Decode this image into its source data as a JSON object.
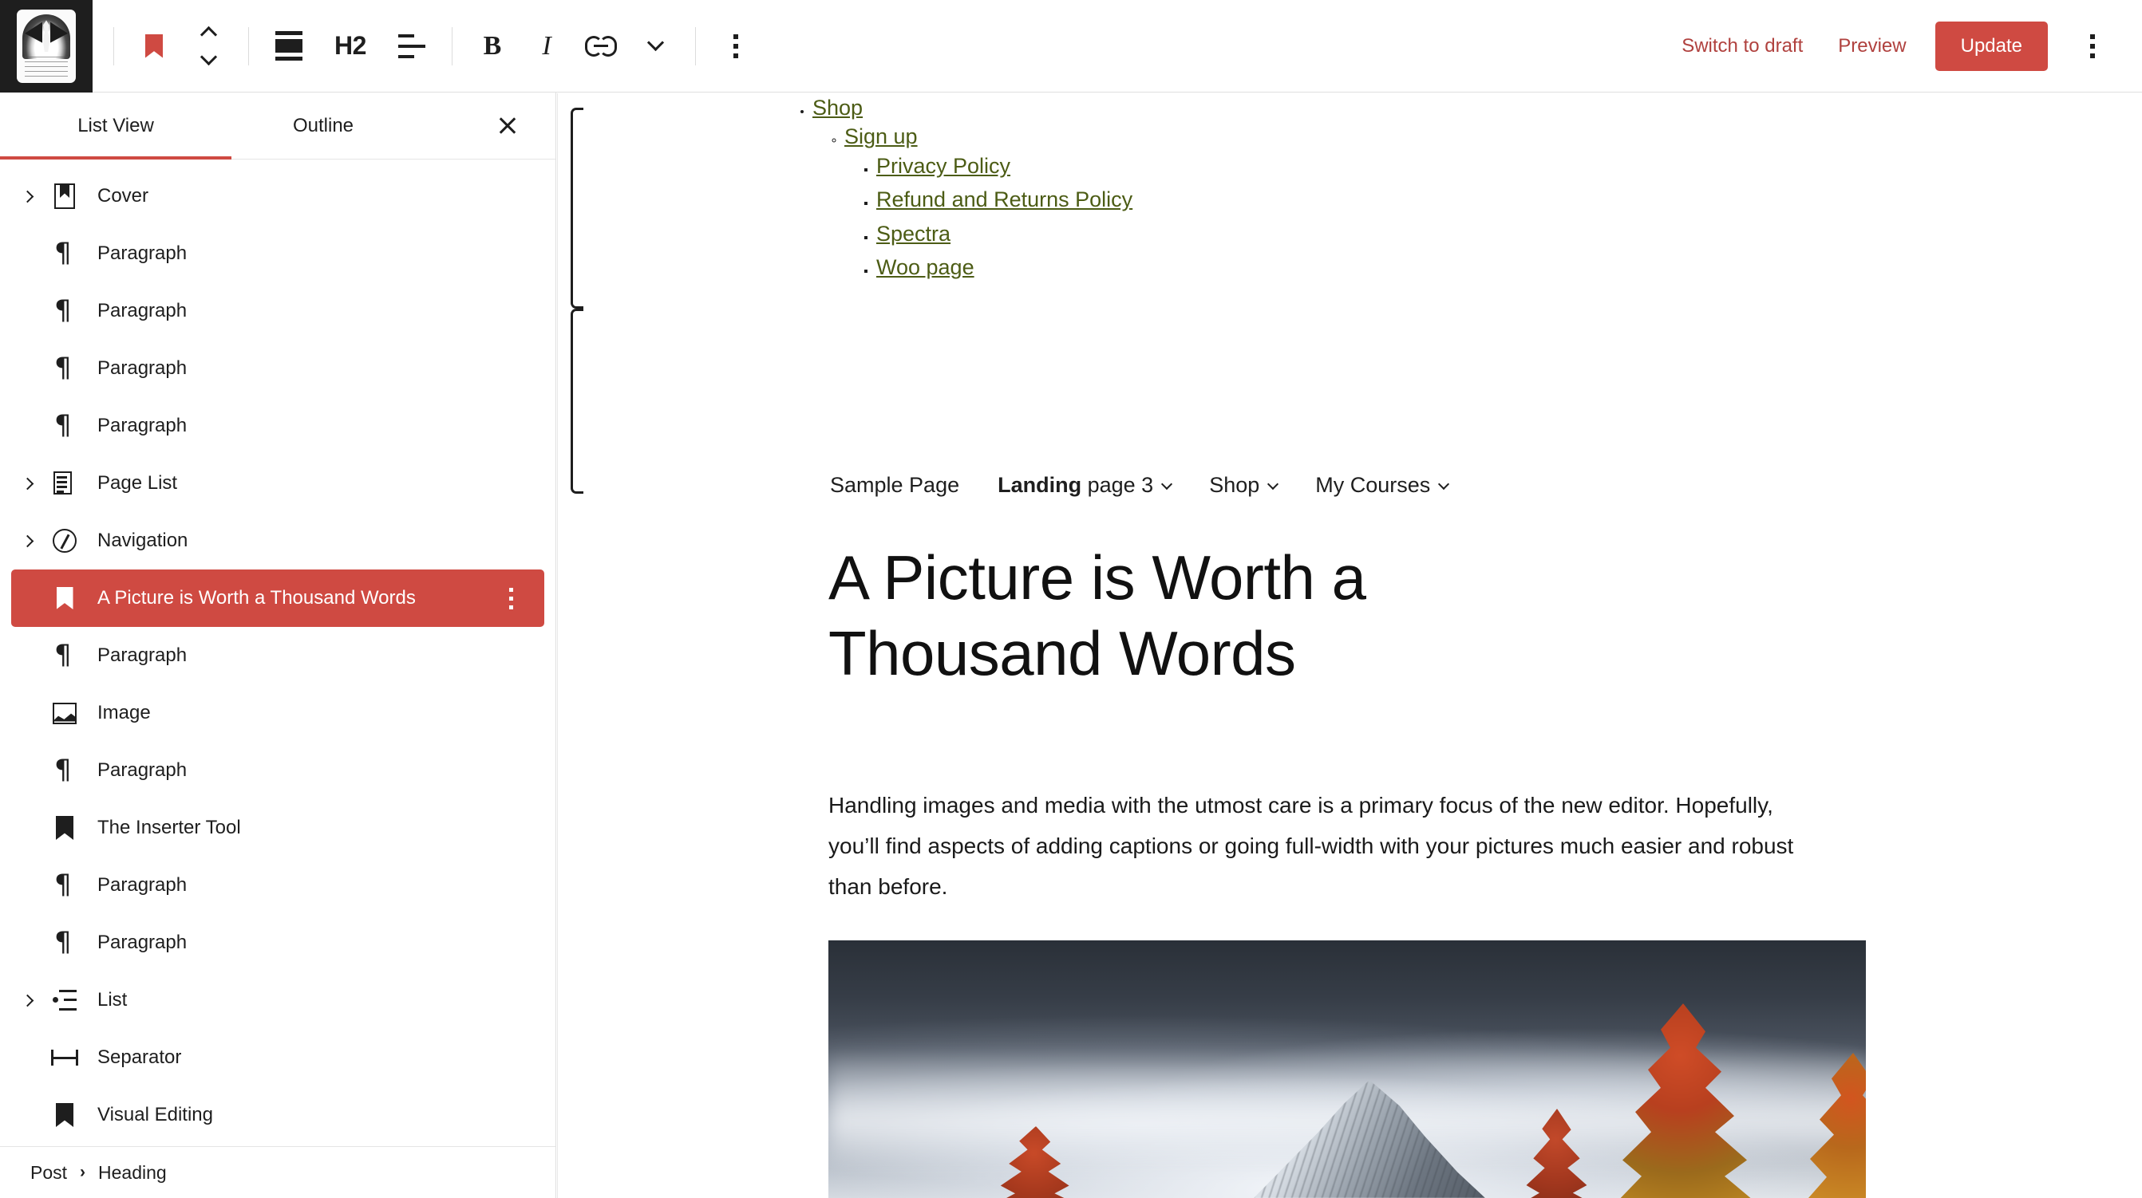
{
  "topbar": {
    "site_logo_alt": "site-icon",
    "tools": [
      {
        "name": "block-type-bookmark",
        "icon": "bookmark-icon",
        "label": ""
      },
      {
        "name": "move-up-down",
        "icon": "chevron-up-down-icon",
        "label": ""
      },
      {
        "name": "block-align",
        "icon": "align-block-icon",
        "label": ""
      },
      {
        "name": "heading-level",
        "icon": "heading-level-icon",
        "label": "H2"
      },
      {
        "name": "text-align",
        "icon": "align-text-icon",
        "label": ""
      },
      {
        "name": "bold",
        "icon": "bold-icon",
        "label": "B"
      },
      {
        "name": "italic",
        "icon": "italic-icon",
        "label": "I"
      },
      {
        "name": "link",
        "icon": "link-icon",
        "label": ""
      },
      {
        "name": "more-rich-text",
        "icon": "chevron-down-icon",
        "label": ""
      },
      {
        "name": "block-options",
        "icon": "kebab-menu-icon",
        "label": ""
      }
    ],
    "heading_level_label": "H2",
    "bold_label": "B",
    "italic_label": "I",
    "switch_to_draft_label": "Switch to draft",
    "preview_label": "Preview",
    "update_label": "Update",
    "more_options_label": "Options"
  },
  "listview": {
    "tabs": [
      {
        "label": "List View",
        "active": true
      },
      {
        "label": "Outline",
        "active": false
      }
    ],
    "close_label": "Close",
    "items": [
      {
        "label": "Cover",
        "icon": "cover-icon",
        "expandable": true,
        "selected": false,
        "indent": 0
      },
      {
        "label": "Paragraph",
        "icon": "paragraph-icon",
        "expandable": false,
        "selected": false,
        "indent": 0
      },
      {
        "label": "Paragraph",
        "icon": "paragraph-icon",
        "expandable": false,
        "selected": false,
        "indent": 0
      },
      {
        "label": "Paragraph",
        "icon": "paragraph-icon",
        "expandable": false,
        "selected": false,
        "indent": 0
      },
      {
        "label": "Paragraph",
        "icon": "paragraph-icon",
        "expandable": false,
        "selected": false,
        "indent": 0
      },
      {
        "label": "Page List",
        "icon": "page-list-icon",
        "expandable": true,
        "selected": false,
        "indent": 0
      },
      {
        "label": "Navigation",
        "icon": "navigation-icon",
        "expandable": true,
        "selected": false,
        "indent": 0
      },
      {
        "label": "A Picture is Worth a Thousand Words",
        "icon": "heading-icon",
        "expandable": false,
        "selected": true,
        "indent": 0
      },
      {
        "label": "Paragraph",
        "icon": "paragraph-icon",
        "expandable": false,
        "selected": false,
        "indent": 0
      },
      {
        "label": "Image",
        "icon": "image-icon",
        "expandable": false,
        "selected": false,
        "indent": 0
      },
      {
        "label": "Paragraph",
        "icon": "paragraph-icon",
        "expandable": false,
        "selected": false,
        "indent": 0
      },
      {
        "label": "The Inserter Tool",
        "icon": "heading-icon",
        "expandable": false,
        "selected": false,
        "indent": 0
      },
      {
        "label": "Paragraph",
        "icon": "paragraph-icon",
        "expandable": false,
        "selected": false,
        "indent": 0
      },
      {
        "label": "Paragraph",
        "icon": "paragraph-icon",
        "expandable": false,
        "selected": false,
        "indent": 0
      },
      {
        "label": "List",
        "icon": "list-icon",
        "expandable": true,
        "selected": false,
        "indent": 0
      },
      {
        "label": "Separator",
        "icon": "separator-icon",
        "expandable": false,
        "selected": false,
        "indent": 0
      },
      {
        "label": "Visual Editing",
        "icon": "heading-icon",
        "expandable": false,
        "selected": false,
        "indent": 0
      }
    ]
  },
  "breadcrumb": {
    "items": [
      "Post",
      "Heading"
    ],
    "separator": "›"
  },
  "content": {
    "link_list": [
      {
        "label": "Shop",
        "level": 1
      },
      {
        "label": "Sign up",
        "level": 2
      },
      {
        "label": "Privacy Policy",
        "level": 3
      },
      {
        "label": "Refund and Returns Policy",
        "level": 3
      },
      {
        "label": "Spectra",
        "level": 3
      },
      {
        "label": "Woo page",
        "level": 3
      }
    ],
    "menu": [
      {
        "label": "Sample Page",
        "bold_prefix": "",
        "caret": false
      },
      {
        "label": " page 3",
        "bold_prefix": "Landing",
        "caret": true
      },
      {
        "label": "Shop",
        "bold_prefix": "",
        "caret": true
      },
      {
        "label": "My Courses",
        "bold_prefix": "",
        "caret": true
      }
    ],
    "title": "A Picture is Worth a Thousand Words",
    "paragraph": "Handling images and media with the utmost care is a primary focus of the new editor. Hopefully, you’ll find aspects of adding captions or going full-width with your pictures much easier and robust than before.",
    "image_alt": "snow-covered-mountain-peak-under-storm-clouds-with-autumn-trees"
  },
  "colors": {
    "accent_red": "#cf4a42",
    "action_red": "#b0413e",
    "link_olive": "#4c5c15",
    "dark_chrome": "#1e1e1e",
    "border_grey": "#e0e0e0"
  }
}
